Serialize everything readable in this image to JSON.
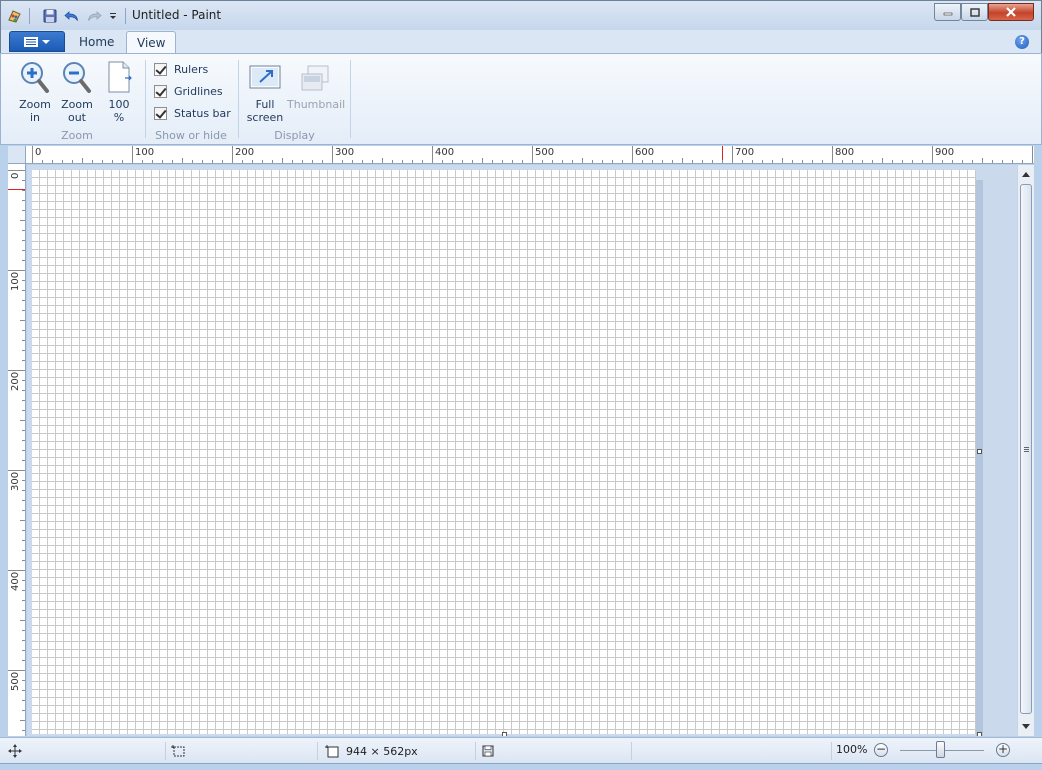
{
  "window": {
    "title": "Untitled - Paint"
  },
  "tabs": {
    "home": "Home",
    "view": "View"
  },
  "ribbon": {
    "zoom_group": {
      "label": "Zoom",
      "zoom_in": [
        "Zoom",
        "in"
      ],
      "zoom_out": [
        "Zoom",
        "out"
      ],
      "hundred": [
        "100",
        "%"
      ]
    },
    "show_hide_group": {
      "label": "Show or hide",
      "rulers": "Rulers",
      "gridlines": "Gridlines",
      "status_bar": "Status bar"
    },
    "display_group": {
      "label": "Display",
      "full_screen": [
        "Full",
        "screen"
      ],
      "thumbnail": "Thumbnail"
    }
  },
  "rulers": {
    "horizontal_labels": [
      "0",
      "100",
      "200",
      "300",
      "400",
      "500",
      "600",
      "700",
      "800",
      "900"
    ],
    "vertical_labels": [
      "0",
      "100",
      "200",
      "300",
      "400",
      "500"
    ]
  },
  "status": {
    "canvas_size": "944 × 562px",
    "zoom_level": "100%"
  },
  "colors": {
    "accent": "#1c5bb5",
    "ribbon_bg": "#e4edf8",
    "workspace": "#cbd9ec"
  }
}
